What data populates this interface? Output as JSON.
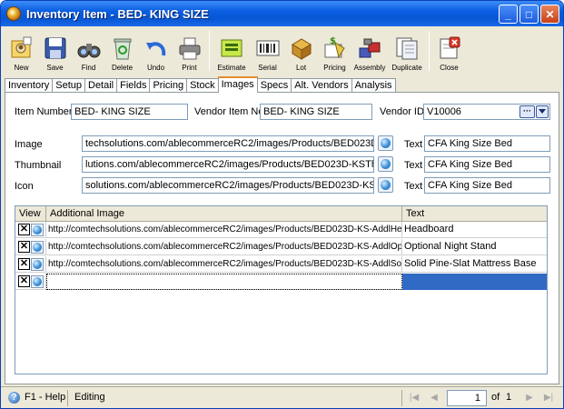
{
  "window": {
    "title": "Inventory Item - BED- KING SIZE",
    "minimize": "_",
    "maximize": "□",
    "close": "✕"
  },
  "toolbar": [
    {
      "id": "new",
      "label": "New",
      "icon": "new-icon"
    },
    {
      "id": "save",
      "label": "Save",
      "icon": "save-icon"
    },
    {
      "id": "find",
      "label": "Find",
      "icon": "binoculars-icon"
    },
    {
      "id": "delete",
      "label": "Delete",
      "icon": "recycle-bin-icon"
    },
    {
      "id": "undo",
      "label": "Undo",
      "icon": "undo-arrow-icon"
    },
    {
      "id": "print",
      "label": "Print",
      "icon": "printer-icon"
    },
    {
      "id": "estimate",
      "label": "Estimate",
      "icon": "estimate-icon"
    },
    {
      "id": "serial",
      "label": "Serial",
      "icon": "barcode-icon"
    },
    {
      "id": "lot",
      "label": "Lot",
      "icon": "lot-icon"
    },
    {
      "id": "pricing",
      "label": "Pricing",
      "icon": "pricing-icon"
    },
    {
      "id": "assembly",
      "label": "Assembly",
      "icon": "assembly-icon"
    },
    {
      "id": "duplicate",
      "label": "Duplicate",
      "icon": "duplicate-icon"
    },
    {
      "id": "close",
      "label": "Close",
      "icon": "close-doc-icon"
    }
  ],
  "tabs": [
    "Inventory",
    "Setup",
    "Detail",
    "Fields",
    "Pricing",
    "Stock",
    "Images",
    "Specs",
    "Alt. Vendors",
    "Analysis"
  ],
  "active_tab": "Images",
  "form": {
    "item_number_label": "Item Number",
    "item_number": "BED- KING SIZE",
    "vendor_item_no_label": "Vendor Item No",
    "vendor_item_no": "BED- KING SIZE",
    "vendor_id_label": "Vendor ID",
    "vendor_id": "V10006",
    "image_label": "Image",
    "image_url": "techsolutions.com/ablecommerceRC2/images/Products/BED023D-KS.jpg",
    "image_text_label": "Text",
    "image_text": "CFA King Size Bed",
    "thumbnail_label": "Thumbnail",
    "thumbnail_url": "lutions.com/ablecommerceRC2/images/Products/BED023D-KSThumb.jpg",
    "thumbnail_text_label": "Text",
    "thumbnail_text": "CFA King Size Bed",
    "icon_label": "Icon",
    "icon_url": "solutions.com/ablecommerceRC2/images/Products/BED023D-KSIcon.jpg",
    "icon_text_label": "Text",
    "icon_text": "CFA King Size Bed"
  },
  "grid": {
    "headers": {
      "view": "View",
      "additional_image": "Additional Image",
      "text": "Text"
    },
    "rows": [
      {
        "url": "http://comtechsolutions.com/ablecommerceRC2/images/Products/BED023D-KS-AddlHea...",
        "text": "Headboard"
      },
      {
        "url": "http://comtechsolutions.com/ablecommerceRC2/images/Products/BED023D-KS-AddlOpt...",
        "text": "Optional Night Stand"
      },
      {
        "url": "http://comtechsolutions.com/ablecommerceRC2/images/Products/BED023D-KS-AddlSoli...",
        "text": "Solid Pine-Slat Mattress Base"
      }
    ],
    "x_glyph": "✕"
  },
  "status": {
    "help": "F1 - Help",
    "mode": "Editing",
    "page": "1",
    "of_label": "of",
    "total": "1"
  },
  "colors": {
    "titlebar": "#0a5ee0",
    "selected_row": "#316ac5",
    "active_tab_accent": "#e68b2c"
  }
}
